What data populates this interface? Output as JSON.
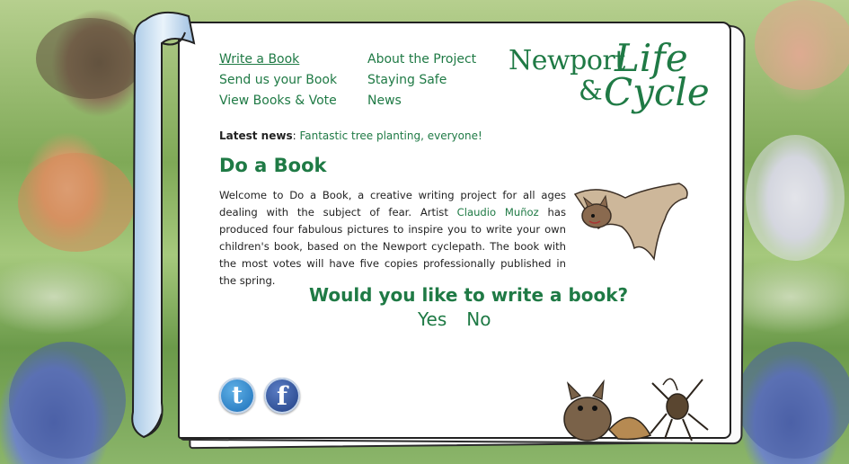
{
  "nav": {
    "col1": [
      "Write a Book",
      "Send us your Book",
      "View Books & Vote"
    ],
    "col2": [
      "About the Project",
      "Staying Safe",
      "News"
    ]
  },
  "logo": {
    "line1a": "Newport",
    "line1b": "Life",
    "line2a": "&",
    "line2b": "Cycle"
  },
  "latest_news": {
    "label": "Latest news",
    "sep": ":",
    "text": "Fantastic tree planting, everyone!"
  },
  "heading": "Do a Book",
  "intro": {
    "part1": "Welcome to Do a Book, a creative writing project for all ages dealing with the subject of fear. Artist ",
    "artist": "Claudio Muñoz",
    "part2": " has produced four fabulous pictures to inspire you to write your own children's book, based on the Newport cyclepath. The book with the most votes will have five copies professionally published in the spring."
  },
  "question": "Would you like to write a book?",
  "answers": {
    "yes": "Yes",
    "no": "No"
  },
  "social": {
    "twitter_icon": "twitter-icon",
    "facebook_icon": "facebook-icon",
    "twitter_glyph": "t",
    "facebook_glyph": "f"
  },
  "colors": {
    "accent": "#1f7a45",
    "text": "#222222",
    "page": "#ffffff"
  }
}
